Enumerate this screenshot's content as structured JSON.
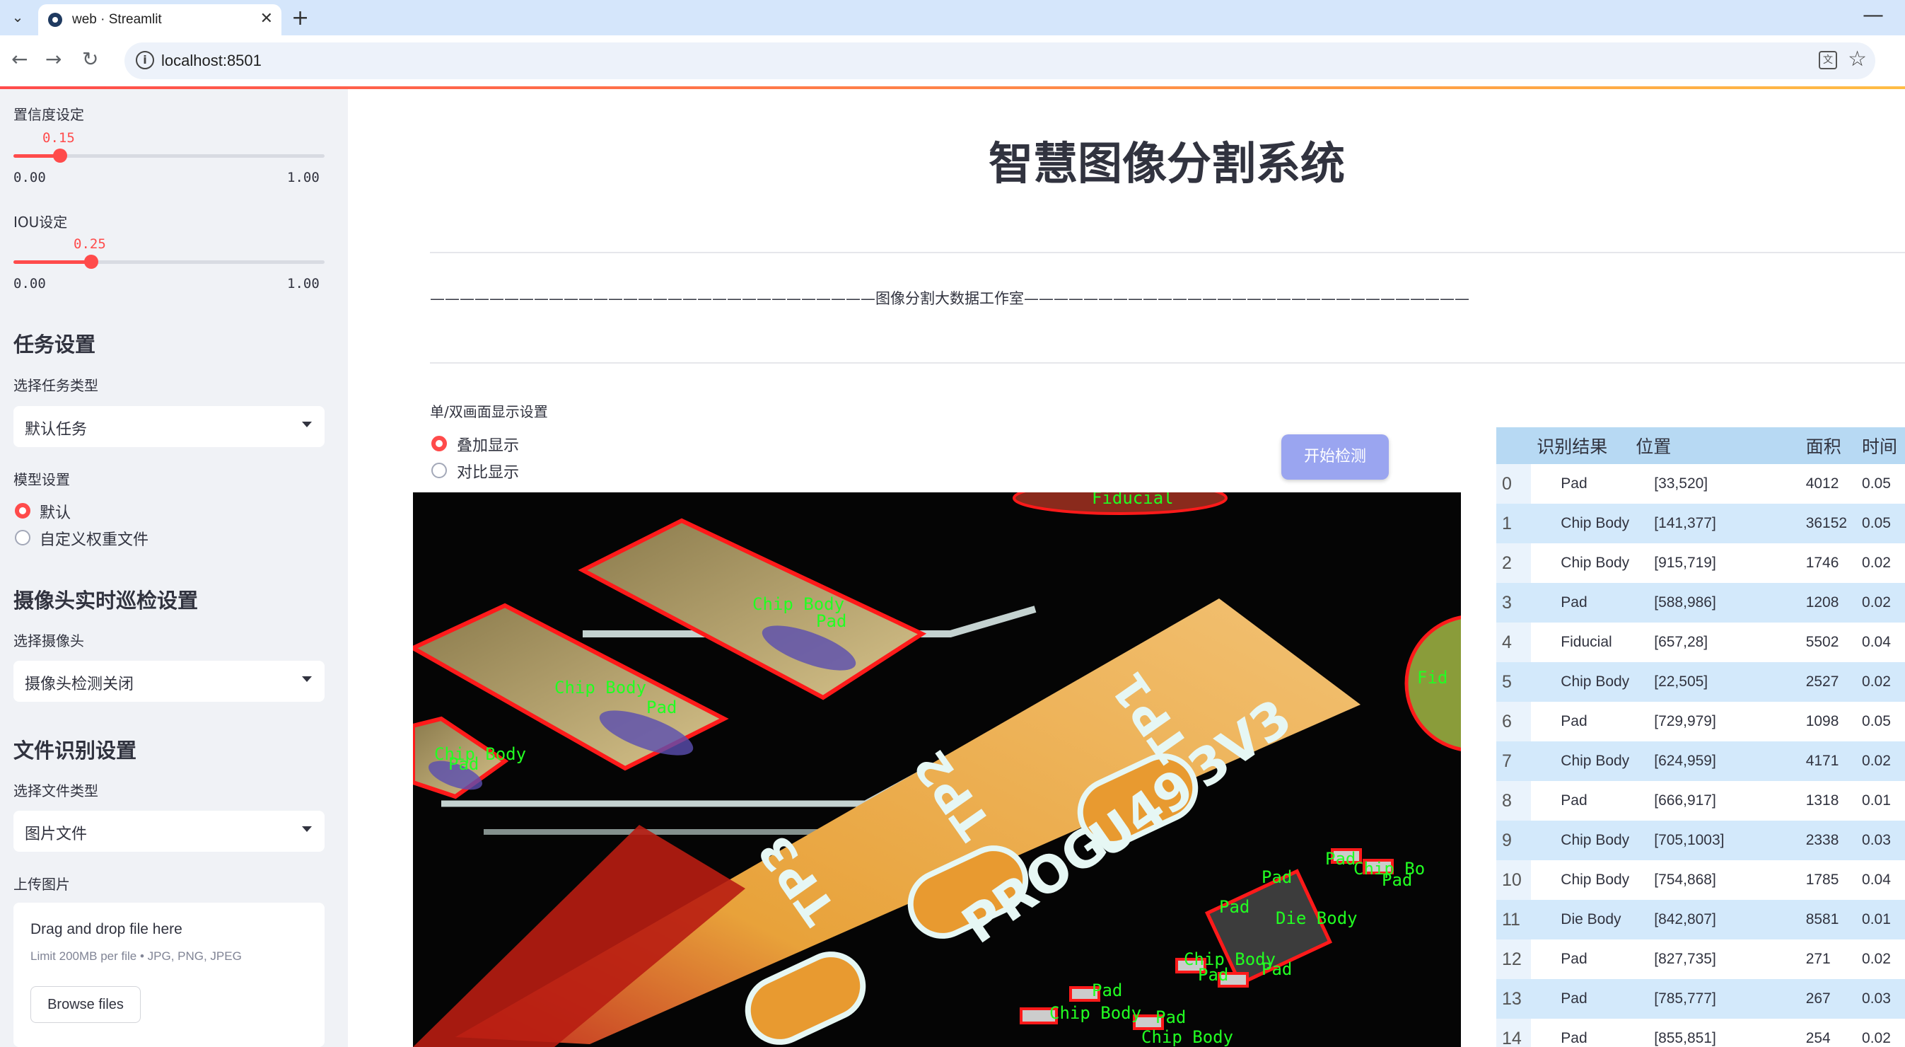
{
  "browser": {
    "tab_title": "web · Streamlit",
    "url": "localhost:8501"
  },
  "sidebar": {
    "confidence": {
      "label": "置信度设定",
      "value": "0.15",
      "min": "0.00",
      "max": "1.00",
      "fraction": 0.15
    },
    "iou": {
      "label": "IOU设定",
      "value": "0.25",
      "min": "0.00",
      "max": "1.00",
      "fraction": 0.25
    },
    "task_section": "任务设置",
    "task_type_label": "选择任务类型",
    "task_type_value": "默认任务",
    "model_label": "模型设置",
    "model_options": [
      "默认",
      "自定义权重文件"
    ],
    "model_selected": "默认",
    "camera_section": "摄像头实时巡检设置",
    "camera_label": "选择摄像头",
    "camera_value": "摄像头检测关闭",
    "file_section": "文件识别设置",
    "file_type_label": "选择文件类型",
    "file_type_value": "图片文件",
    "upload_label": "上传图片",
    "upload_drag_text": "Drag and drop file here",
    "upload_limit_text": "Limit 200MB per file • JPG, PNG, JPEG",
    "browse_button": "Browse files"
  },
  "main": {
    "title": "智慧图像分割系统",
    "divider_text": "——————————————————————————————图像分割大数据工作室——————————————————————————————",
    "display_label": "单/双画面显示设置",
    "display_options": [
      "叠加显示",
      "对比显示"
    ],
    "display_selected": "叠加显示",
    "start_button": "开始检测"
  },
  "image_labels": [
    "Fiducial",
    "Chip Body",
    "Pad",
    "Chip Body",
    "Pad",
    "Chip Body",
    "Pad",
    "Fid",
    "Pad",
    "Chip Bo",
    "Pad",
    "Pad",
    "Die Body",
    "Pad",
    "Chip Body",
    "Pad",
    "Pad",
    "Pad",
    "Chip Body",
    "Pad",
    "Chip Body"
  ],
  "table": {
    "headers": [
      "",
      "识别结果",
      "位置",
      "面积",
      "时间"
    ],
    "rows": [
      [
        "0",
        "Pad",
        "[33,520]",
        "4012",
        "0.05"
      ],
      [
        "1",
        "Chip Body",
        "[141,377]",
        "36152",
        "0.05"
      ],
      [
        "2",
        "Chip Body",
        "[915,719]",
        "1746",
        "0.02"
      ],
      [
        "3",
        "Pad",
        "[588,986]",
        "1208",
        "0.02"
      ],
      [
        "4",
        "Fiducial",
        "[657,28]",
        "5502",
        "0.04"
      ],
      [
        "5",
        "Chip Body",
        "[22,505]",
        "2527",
        "0.02"
      ],
      [
        "6",
        "Pad",
        "[729,979]",
        "1098",
        "0.05"
      ],
      [
        "7",
        "Chip Body",
        "[624,959]",
        "4171",
        "0.02"
      ],
      [
        "8",
        "Pad",
        "[666,917]",
        "1318",
        "0.01"
      ],
      [
        "9",
        "Chip Body",
        "[705,1003]",
        "2338",
        "0.03"
      ],
      [
        "10",
        "Chip Body",
        "[754,868]",
        "1785",
        "0.04"
      ],
      [
        "11",
        "Die Body",
        "[842,807]",
        "8581",
        "0.01"
      ],
      [
        "12",
        "Pad",
        "[827,735]",
        "271",
        "0.02"
      ],
      [
        "13",
        "Pad",
        "[785,777]",
        "267",
        "0.03"
      ],
      [
        "14",
        "Pad",
        "[855,851]",
        "254",
        "0.02"
      ]
    ]
  }
}
